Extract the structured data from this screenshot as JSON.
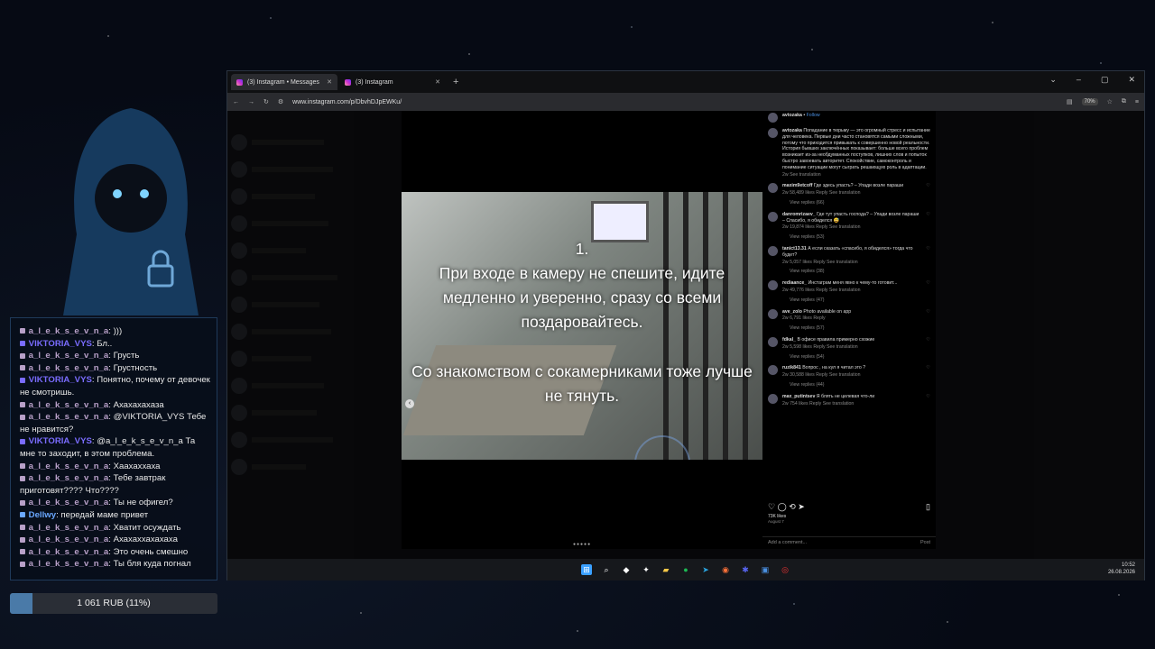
{
  "chat": {
    "messages": [
      {
        "user": "a_l_e_k_s_e_v_n_a",
        "text": ")))",
        "color": "#b8a0c8"
      },
      {
        "user": "VIKTORIA_VYS",
        "text": "Бл..",
        "color": "#7a6cff"
      },
      {
        "user": "a_l_e_k_s_e_v_n_a",
        "text": "Грусть",
        "color": "#b8a0c8"
      },
      {
        "user": "a_l_e_k_s_e_v_n_a",
        "text": "Грустность",
        "color": "#b8a0c8"
      },
      {
        "user": "VIKTORIA_VYS",
        "text": "Понятно, почему от девочек не смотришь.",
        "color": "#7a6cff"
      },
      {
        "user": "a_l_e_k_s_e_v_n_a",
        "text": "Ахахахахаза",
        "color": "#b8a0c8"
      },
      {
        "user": "a_l_e_k_s_e_v_n_a",
        "text": "@VIKTORIA_VYS Тебе не нравится?",
        "color": "#b8a0c8"
      },
      {
        "user": "VIKTORIA_VYS",
        "text": "@a_l_e_k_s_e_v_n_a Та мне то заходит, в этом проблема.",
        "color": "#7a6cff"
      },
      {
        "user": "a_l_e_k_s_e_v_n_a",
        "text": "Хаахаххаха",
        "color": "#b8a0c8"
      },
      {
        "user": "a_l_e_k_s_e_v_n_a",
        "text": "Тебе завтрак приготовят???? Что????",
        "color": "#b8a0c8"
      },
      {
        "user": "a_l_e_k_s_e_v_n_a",
        "text": "Ты не офигел?",
        "color": "#b8a0c8"
      },
      {
        "user": "Dellwy",
        "text": "передай маме привет",
        "color": "#6aa8ff"
      },
      {
        "user": "a_l_e_k_s_e_v_n_a",
        "text": "Хватит осуждать",
        "color": "#b8a0c8"
      },
      {
        "user": "a_l_e_k_s_e_v_n_a",
        "text": "Ахахаххахахаха",
        "color": "#b8a0c8"
      },
      {
        "user": "a_l_e_k_s_e_v_n_a",
        "text": "Это очень смешно",
        "color": "#b8a0c8"
      },
      {
        "user": "a_l_e_k_s_e_v_n_a",
        "text": "Ты бля куда погнал",
        "color": "#b8a0c8"
      }
    ]
  },
  "donation": {
    "label": "1 061 RUB (11%)",
    "progress": 0.11
  },
  "browser": {
    "tabs": [
      {
        "label": "(3) Instagram • Messages"
      },
      {
        "label": "(3) Instagram"
      }
    ],
    "new_tab": "+",
    "url": "www.instagram.com/p/DbvhDJpEWKu/",
    "zoom": "70%"
  },
  "post": {
    "author": "avtozaka",
    "follow": "Follow",
    "overlay_1": "1.",
    "overlay_2": "При входе в камеру не спешите, идите медленно и уверенно, сразу со всеми поздаровайтесь.",
    "overlay_3": "Со знакомством с сокамерниками тоже лучше не тянуть.",
    "caption": "Попадание в тюрьму — это огромный стресс и испытание для человека. Первые дни часто становятся самыми сложными, потому что приходится привыкать к совершенно новой реальности. История бывших заключённых показывает: больше всего проблем возникает из-за необдуманных поступков, лишних слов и попыток быстро завоевать авторитет. Спокойствие, самоконтроль и понимание ситуации могут сыграть решающую роль в адаптации.",
    "caption_meta": "2w  See translation",
    "likes": "73K likes",
    "date": "August 7",
    "add_comment": "Add a comment...",
    "post_btn": "Post"
  },
  "comments": [
    {
      "user": "maxim9etcoff",
      "text": "Где здесь упасть? – Упади возле параши",
      "meta": "2w  58,489 likes  Reply  See translation",
      "replies": "View replies (66)"
    },
    {
      "user": "danromrizaev_",
      "text": "Где тут упасть господа? – Упади возле параши – Спасибо, я обиделся 😅",
      "meta": "2w  19,874 likes  Reply  See translation",
      "replies": "View replies (53)"
    },
    {
      "user": "tanict13.31",
      "text": "А если сказать «спасибо, я обиделся» тогда что будет?",
      "meta": "2w  5,057 likes  Reply  See translation",
      "replies": "View replies (38)"
    },
    {
      "user": "rediaance_",
      "text": "Инстаграм меня явно к чему-то готовит...",
      "meta": "2w  49,776 likes  Reply  See translation",
      "replies": "View replies (47)"
    },
    {
      "user": "ave_zolo",
      "text": "Photo available on app",
      "meta": "2w  6,791 likes  Reply",
      "replies": "View replies (57)"
    },
    {
      "user": "fdkal_",
      "text": "В офисе правила примерно схожие",
      "meta": "2w  5,598 likes  Reply  See translation",
      "replies": "View replies (54)"
    },
    {
      "user": "ruzik841",
      "text": "Вопрос , на кул я читал это ?",
      "meta": "2w  30,588 likes  Reply  See translation",
      "replies": "View replies (44)"
    },
    {
      "user": "max_putintsev",
      "text": "Я блять не целевая что-ли",
      "meta": "2w  754 likes  Reply  See translation",
      "replies": ""
    }
  ],
  "taskbar": {
    "time": "10:52",
    "date": "26.08.2026"
  }
}
